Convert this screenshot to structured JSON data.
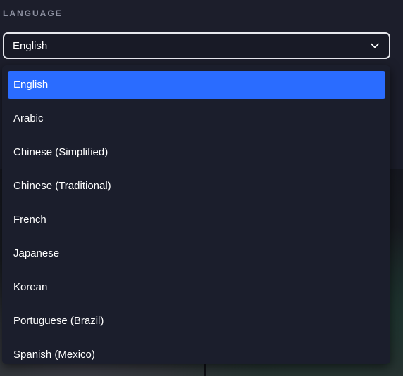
{
  "language": {
    "section_label": "LANGUAGE",
    "selected_value": "English",
    "chevron_icon": "chevron-down-icon",
    "accent_color": "#2a6cff",
    "options": [
      {
        "label": "English",
        "selected": true
      },
      {
        "label": "Arabic",
        "selected": false
      },
      {
        "label": "Chinese (Simplified)",
        "selected": false
      },
      {
        "label": "Chinese (Traditional)",
        "selected": false
      },
      {
        "label": "French",
        "selected": false
      },
      {
        "label": "Japanese",
        "selected": false
      },
      {
        "label": "Korean",
        "selected": false
      },
      {
        "label": "Portuguese (Brazil)",
        "selected": false
      },
      {
        "label": "Spanish (Mexico)",
        "selected": false
      }
    ]
  }
}
